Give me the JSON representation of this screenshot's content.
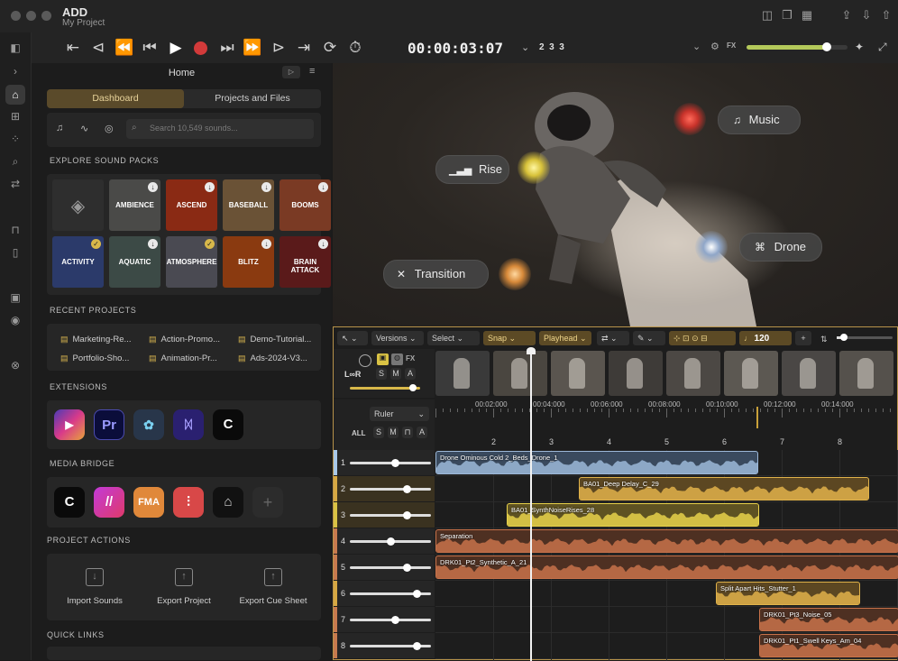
{
  "app": {
    "title": "ADD",
    "project": "My Project"
  },
  "transport": {
    "timecode": "00:00:03:07",
    "bars": "2  3  3"
  },
  "browser": {
    "title": "Home",
    "tabs": [
      "Dashboard",
      "Projects and Files"
    ],
    "search_placeholder": "Search 10,549 sounds...",
    "sections": {
      "packs": "EXPLORE SOUND PACKS",
      "recent": "RECENT PROJECTS",
      "extensions": "EXTENSIONS",
      "media": "MEDIA BRIDGE",
      "actions": "PROJECT ACTIONS",
      "links": "QUICK LINKS"
    },
    "packs_row1": [
      {
        "label": "",
        "bg": "#2e2e2e"
      },
      {
        "label": "AMBIENCE",
        "bg": "#4a4a48"
      },
      {
        "label": "ASCEND",
        "bg": "#8a2a14"
      },
      {
        "label": "BASEBALL",
        "bg": "#6a5236"
      },
      {
        "label": "BOOMS",
        "bg": "#7a3a24"
      }
    ],
    "packs_row2": [
      {
        "label": "ACTIVITY",
        "bg": "#2b3a6a"
      },
      {
        "label": "AQUATIC",
        "bg": "#3c4a46"
      },
      {
        "label": "ATMOSPHERE",
        "bg": "#4a4a52"
      },
      {
        "label": "BLITZ",
        "bg": "#8a3a10"
      },
      {
        "label": "BRAIN ATTACK",
        "bg": "#5a1a1a"
      }
    ],
    "recent_projects": [
      "Marketing-Re...",
      "Action-Promo...",
      "Demo-Tutorial...",
      "Portfolio-Sho...",
      "Animation-Pr...",
      "Ads-2024-V3..."
    ],
    "actions": [
      "Import Sounds",
      "Export Project",
      "Export Cue Sheet"
    ]
  },
  "video": {
    "labels": [
      "Music",
      "Rise",
      "Drone",
      "Transition"
    ]
  },
  "timeline": {
    "toolbar": {
      "versions": "Versions",
      "select": "Select",
      "snap": "Snap",
      "playhead": "Playhead",
      "tempo": "120"
    },
    "ruler_label": "Ruler",
    "loop": "L∞R",
    "buttons": [
      "S",
      "M",
      "A"
    ],
    "all_label": "ALL",
    "timecodes": [
      "00:02:000",
      "00:04:000",
      "00:06:000",
      "00:08:000",
      "00:10:000",
      "00:12:000",
      "00:14:000"
    ],
    "bars": [
      "2",
      "3",
      "4",
      "5",
      "6",
      "7",
      "8"
    ],
    "tracks": [
      {
        "num": "1",
        "level": 0.55,
        "color": "#a9c8e8"
      },
      {
        "num": "2",
        "level": 0.7,
        "color": "#d6a843"
      },
      {
        "num": "3",
        "level": 0.7,
        "color": "#d9c244"
      },
      {
        "num": "4",
        "level": 0.5,
        "color": "#c77a4e"
      },
      {
        "num": "5",
        "level": 0.7,
        "color": "#c77a4e"
      },
      {
        "num": "6",
        "level": 0.82,
        "color": "#d6a843"
      },
      {
        "num": "7",
        "level": 0.55,
        "color": "#c77a4e"
      },
      {
        "num": "8",
        "level": 0.82,
        "color": "#c77a4e"
      }
    ],
    "clips": [
      "Drone Ominous Cold 2_Beds_Drone_1",
      "BA01_Deep Delay_C_29",
      "BA01_SynthNoiseRises_28",
      "Separation",
      "DRK01_Pt2_Synthetic_A_21",
      "Split Apart Hits_Stutter_1",
      "DRK01_Pt3_Noise_05",
      "DRK01_Pt1_Swell Keys_Am_04"
    ]
  }
}
